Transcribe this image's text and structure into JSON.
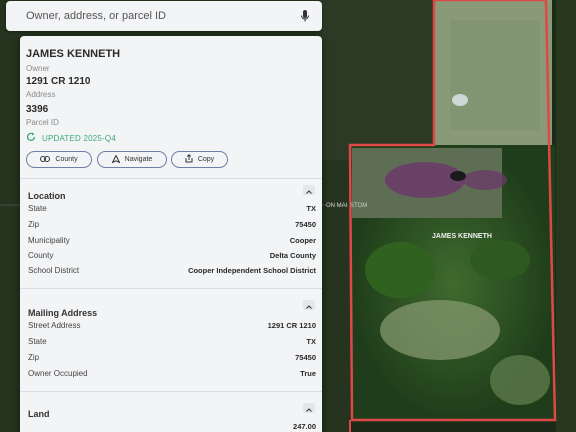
{
  "search": {
    "placeholder": "Owner, address, or parcel ID"
  },
  "map": {
    "parcel_label": "JAMES KENNETH",
    "road_label": "ON MAI",
    "road_label_2": "STOM",
    "boundary_color": "#e04848"
  },
  "parcel": {
    "owner_name": "JAMES KENNETH",
    "owner_caption": "Owner",
    "address": "1291 CR 1210",
    "address_caption": "Address",
    "parcel_id": "3396",
    "parcel_id_caption": "Parcel ID",
    "updated": "UPDATED 2025-Q4"
  },
  "actions": {
    "county": "County",
    "navigate": "Navigate",
    "copy": "Copy"
  },
  "location": {
    "title": "Location",
    "rows": [
      {
        "label": "State",
        "value": "TX"
      },
      {
        "label": "Zip",
        "value": "75450"
      },
      {
        "label": "Municipality",
        "value": "Cooper"
      },
      {
        "label": "County",
        "value": "Delta County"
      },
      {
        "label": "School District",
        "value": "Cooper Independent School District"
      }
    ]
  },
  "mailing": {
    "title": "Mailing Address",
    "rows": [
      {
        "label": "Street Address",
        "value": "1291 CR 1210"
      },
      {
        "label": "State",
        "value": "TX"
      },
      {
        "label": "Zip",
        "value": "75450"
      },
      {
        "label": "Owner Occupied",
        "value": "True"
      }
    ]
  },
  "land": {
    "title": "Land",
    "first_value": "247.00"
  },
  "colors": {
    "accent_green": "#3aa874",
    "button_border": "#6f7fa6"
  }
}
